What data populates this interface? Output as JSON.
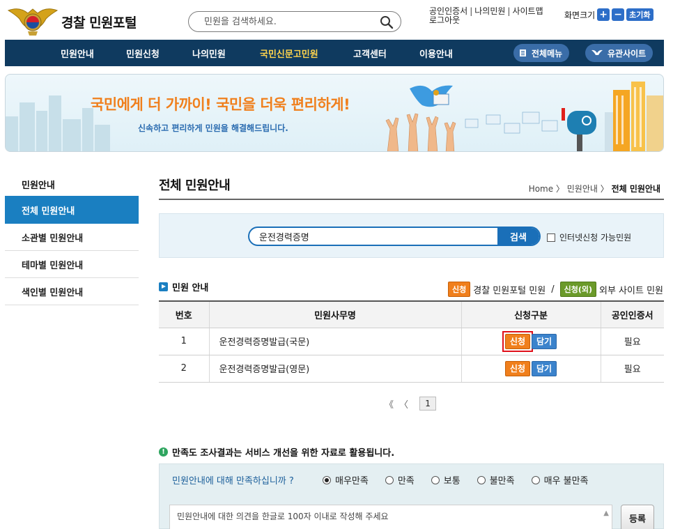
{
  "header": {
    "site_title": "경찰 민원포털",
    "search_placeholder": "민원을 검색하세요.",
    "util_links": [
      "공인인증서",
      "나의민원",
      "사이트맵",
      "로그아웃"
    ],
    "font_size_label": "화면크기",
    "font_plus": "+",
    "font_minus": "−",
    "font_reset": "초기화"
  },
  "gnb": {
    "items": [
      "민원안내",
      "민원신청",
      "나의민원",
      "국민신문고민원",
      "고객센터",
      "이용안내"
    ],
    "active_index": 3,
    "all_menu": "전체메뉴",
    "related_sites": "유관사이트"
  },
  "banner": {
    "title": "국민에게 더 가까이! 국민을 더욱 편리하게!",
    "subtitle": "신속하고 편리하게 민원을 해결해드립니다."
  },
  "sidebar": {
    "title": "민원안내",
    "items": [
      "전체 민원안내",
      "소관별 민원안내",
      "테마별 민원안내",
      "색인별 민원안내"
    ],
    "active_index": 0
  },
  "content": {
    "page_title": "전체 민원안내",
    "breadcrumb": [
      "Home",
      "민원안내",
      "전체 민원안내"
    ],
    "search_value": "운전경력증명",
    "search_button": "검색",
    "online_only_label": "인터넷신청 가능민원",
    "section_title": "민원 안내",
    "legend": {
      "apply_tag": "신청",
      "apply_desc": "경찰 민원포털 민원",
      "slash": "/",
      "external_tag": "신청(외)",
      "external_desc": "외부 사이트 민원"
    },
    "table": {
      "headers": [
        "번호",
        "민원사무명",
        "신청구분",
        "공인인증서"
      ],
      "rows": [
        {
          "no": "1",
          "name": "운전경력증명발급(국문)",
          "apply": "신청",
          "cart": "담기",
          "cert": "필요"
        },
        {
          "no": "2",
          "name": "운전경력증명발급(영문)",
          "apply": "신청",
          "cart": "담기",
          "cert": "필요"
        }
      ]
    },
    "pager": {
      "first": "《",
      "prev": "〈",
      "current": "1"
    }
  },
  "survey": {
    "note": "만족도 조사결과는 서비스 개선을 위한 자료로 활용됩니다.",
    "question": "민원안내에 대해 만족하십니까 ?",
    "options": [
      "매우만족",
      "만족",
      "보통",
      "불만족",
      "매우 불만족"
    ],
    "selected_index": 0,
    "comment_placeholder": "민원안내에 대한 의견을 한글로 100자 이내로 작성해 주세요",
    "submit": "등록"
  },
  "colors": {
    "gnb_bg": "#0f3a5f",
    "gnb_active": "#ffd44d",
    "primary_blue": "#1a7fc1",
    "apply_orange": "#f07f1c",
    "external_green": "#6b9a2a",
    "highlight_red": "#e0101a"
  }
}
